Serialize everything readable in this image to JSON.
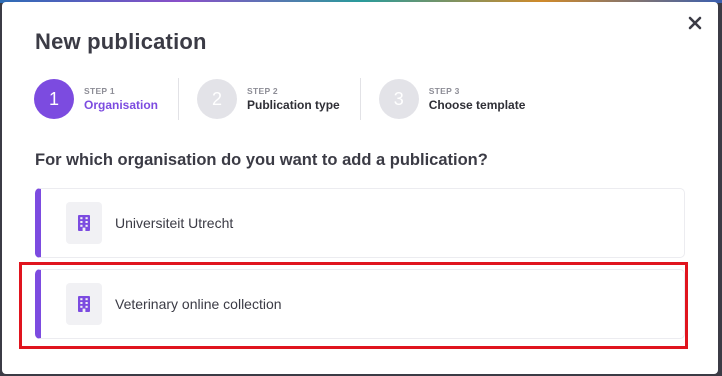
{
  "dialog": {
    "title": "New publication",
    "close_icon": "close-icon"
  },
  "steps": [
    {
      "number": "1",
      "label": "STEP 1",
      "name": "Organisation",
      "state": "active"
    },
    {
      "number": "2",
      "label": "STEP 2",
      "name": "Publication type",
      "state": "inactive"
    },
    {
      "number": "3",
      "label": "STEP 3",
      "name": "Choose template",
      "state": "inactive"
    }
  ],
  "question": "For which organisation do you want to add a publication?",
  "organisations": [
    {
      "name": "Universiteit Utrecht",
      "icon": "building-icon"
    },
    {
      "name": "Veterinary online collection",
      "icon": "building-icon"
    }
  ],
  "colors": {
    "accent": "#7c4be0",
    "highlight": "#e0141e",
    "inactive_step": "#e3e3e8",
    "text": "#3b3b45"
  }
}
